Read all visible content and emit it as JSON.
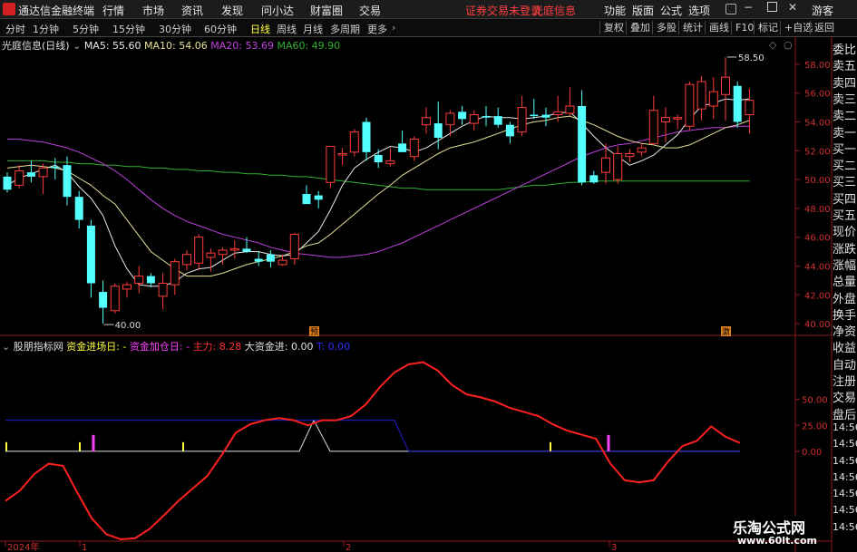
{
  "app": {
    "title": "通达信金融终端",
    "notice": "证券交易未登录",
    "stock_name": "光庭信息"
  },
  "menu": [
    "行情",
    "市场",
    "资讯",
    "发现",
    "问小达",
    "财富圈",
    "交易"
  ],
  "right_menu": [
    "功能",
    "版面",
    "公式",
    "选项",
    "游客"
  ],
  "timeframes": [
    "分时",
    "1分钟",
    "5分钟",
    "15分钟",
    "30分钟",
    "60分钟",
    "日线",
    "周线",
    "月线",
    "多周期",
    "更多"
  ],
  "active_timeframe": "日线",
  "toolbar_buttons": [
    "复权",
    "叠加",
    "多股",
    "统计",
    "画线",
    "F10",
    "标记",
    "+自选",
    "返回"
  ],
  "ma_header": {
    "title": "光庭信息(日线)",
    "ma5": "MA5: 55.60",
    "ma10": "MA10: 54.06",
    "ma20": "MA20: 53.69",
    "ma60": "MA60: 49.90"
  },
  "indicator_header": {
    "name": "股朋指标网",
    "i1": "资金进场日: -",
    "i2": "资金加仓日: -",
    "i3": "主力: 8.28",
    "i4": "大资金进: 0.00",
    "i5": "T: 0.00"
  },
  "price_axis": [
    "58.00",
    "56.00",
    "54.00",
    "52.00",
    "50.00",
    "48.00",
    "46.00",
    "44.00",
    "42.00",
    "40.00"
  ],
  "ind_axis": [
    "50.00",
    "25.00",
    "0.00"
  ],
  "annotations": {
    "high": "58.50",
    "low": "40.00",
    "marker_pre": "预",
    "marker_ji": "激"
  },
  "date_axis": [
    "2024年",
    "1",
    "2",
    "3"
  ],
  "sidebar": [
    "委比",
    "卖五",
    "卖四",
    "卖三",
    "卖二",
    "卖一",
    "买一",
    "买二",
    "买三",
    "买四",
    "买五",
    "现价",
    "涨跌",
    "涨幅",
    "总量",
    "外盘",
    "换手",
    "净资",
    "收益",
    "自动",
    "注册",
    "交易",
    "盘后",
    "14:56",
    "14:56",
    "14:56",
    "14:56",
    "14:56",
    "14:56",
    "14:56"
  ],
  "watermark": {
    "line1": "乐淘公式网",
    "line2": "www.60lt.com"
  },
  "colors": {
    "up": "#ff3c3c",
    "down": "#54ffff",
    "ma5": "#e8e8e8",
    "ma10": "#e8e09a",
    "ma20": "#c040e0",
    "ma60": "#30b030"
  },
  "chart_data": {
    "type": "candlestick",
    "y_range": [
      39.5,
      59.0
    ],
    "candles": [
      [
        50.2,
        50.5,
        49.1,
        49.3
      ],
      [
        49.6,
        51.0,
        49.4,
        50.6
      ],
      [
        50.5,
        51.3,
        49.8,
        50.2
      ],
      [
        50.2,
        51.1,
        49.0,
        50.8
      ],
      [
        50.9,
        51.5,
        50.0,
        50.8
      ],
      [
        51.0,
        51.6,
        48.2,
        48.8
      ],
      [
        48.8,
        49.2,
        46.6,
        47.2
      ],
      [
        46.8,
        47.2,
        41.8,
        42.8
      ],
      [
        42.2,
        43.0,
        40.0,
        41.1
      ],
      [
        40.9,
        42.8,
        40.7,
        42.6
      ],
      [
        42.4,
        42.9,
        41.8,
        42.7
      ],
      [
        42.8,
        44.0,
        42.1,
        43.3
      ],
      [
        43.3,
        43.5,
        42.5,
        42.8
      ],
      [
        41.9,
        43.5,
        41.0,
        42.8
      ],
      [
        42.7,
        44.5,
        42.0,
        44.3
      ],
      [
        44.1,
        45.1,
        43.7,
        44.8
      ],
      [
        44.2,
        46.2,
        43.7,
        46.0
      ],
      [
        44.6,
        45.2,
        43.6,
        44.9
      ],
      [
        44.8,
        45.3,
        44.1,
        45.1
      ],
      [
        45.1,
        45.8,
        44.5,
        45.2
      ],
      [
        45.2,
        46.0,
        44.9,
        45.0
      ],
      [
        44.5,
        45.0,
        44.0,
        44.3
      ],
      [
        44.8,
        45.1,
        43.9,
        44.3
      ],
      [
        44.1,
        44.8,
        44.0,
        44.4
      ],
      [
        44.5,
        46.3,
        44.1,
        46.2
      ],
      [
        49.0,
        49.6,
        48.6,
        48.3
      ],
      [
        48.9,
        49.2,
        48.0,
        48.6
      ],
      [
        49.8,
        52.3,
        49.4,
        52.3
      ],
      [
        51.7,
        52.2,
        51.0,
        51.8
      ],
      [
        51.9,
        53.5,
        51.6,
        53.3
      ],
      [
        54.0,
        54.3,
        51.3,
        51.9
      ],
      [
        51.7,
        52.1,
        50.8,
        51.2
      ],
      [
        51.1,
        52.2,
        50.9,
        51.3
      ],
      [
        52.5,
        53.4,
        52.5,
        51.9
      ],
      [
        51.6,
        53.0,
        51.3,
        52.8
      ],
      [
        53.8,
        55.0,
        53.2,
        54.3
      ],
      [
        53.9,
        55.4,
        52.1,
        52.9
      ],
      [
        53.8,
        54.8,
        53.0,
        54.6
      ],
      [
        54.7,
        55.1,
        53.8,
        54.2
      ],
      [
        53.9,
        54.8,
        53.4,
        54.5
      ],
      [
        54.4,
        55.1,
        53.7,
        54.3
      ],
      [
        54.4,
        55.0,
        53.6,
        53.8
      ],
      [
        53.8,
        54.0,
        52.5,
        53.0
      ],
      [
        53.3,
        55.8,
        53.0,
        55.0
      ],
      [
        54.5,
        55.6,
        54.2,
        54.4
      ],
      [
        54.5,
        55.0,
        53.7,
        54.3
      ],
      [
        54.5,
        55.8,
        54.0,
        54.7
      ],
      [
        54.6,
        56.4,
        54.4,
        55.1
      ],
      [
        55.1,
        56.2,
        49.6,
        49.8
      ],
      [
        50.3,
        50.6,
        49.7,
        49.8
      ],
      [
        50.5,
        52.5,
        49.7,
        51.5
      ],
      [
        50.0,
        52.3,
        49.7,
        51.8
      ],
      [
        51.6,
        52.1,
        51.2,
        51.8
      ],
      [
        51.9,
        52.5,
        51.6,
        52.2
      ],
      [
        52.5,
        55.8,
        52.4,
        54.8
      ],
      [
        54.0,
        55.0,
        52.6,
        54.3
      ],
      [
        54.2,
        54.5,
        53.5,
        54.3
      ],
      [
        53.7,
        56.8,
        53.4,
        56.6
      ],
      [
        54.9,
        57.2,
        54.1,
        56.8
      ],
      [
        55.1,
        57.1,
        54.2,
        56.1
      ],
      [
        55.9,
        58.5,
        54.1,
        57.1
      ],
      [
        56.5,
        56.8,
        53.6,
        54.0
      ],
      [
        54.5,
        56.3,
        53.2,
        55.5
      ]
    ],
    "ma5": [
      49.6,
      50.1,
      50.4,
      50.7,
      51.0,
      50.5,
      49.5,
      48.7,
      47.5,
      45.4,
      43.8,
      42.7,
      42.6,
      42.6,
      42.9,
      43.5,
      43.8,
      43.9,
      44.4,
      44.9,
      45.0,
      45.0,
      44.8,
      44.7,
      44.8,
      45.6,
      46.4,
      47.9,
      49.6,
      50.8,
      51.4,
      51.9,
      52.3,
      52.2,
      51.9,
      52.2,
      52.7,
      53.2,
      53.7,
      54.1,
      54.4,
      54.3,
      54.3,
      54.2,
      54.3,
      54.4,
      54.6,
      54.7,
      53.9,
      53.0,
      52.2,
      51.6,
      51.0,
      51.3,
      51.7,
      52.4,
      53.1,
      54.2,
      55.1,
      55.3,
      55.6,
      55.5,
      55.6
    ],
    "ma10": [
      50.8,
      50.9,
      51.0,
      50.9,
      50.8,
      50.6,
      50.1,
      49.6,
      48.9,
      48.3,
      47.2,
      46.1,
      45.0,
      44.4,
      43.8,
      43.3,
      43.3,
      43.3,
      43.5,
      43.8,
      44.1,
      44.3,
      44.5,
      44.7,
      45.0,
      45.4,
      45.6,
      46.2,
      46.9,
      47.6,
      48.3,
      49.0,
      49.6,
      50.3,
      50.8,
      51.3,
      51.8,
      52.2,
      52.4,
      52.6,
      52.9,
      53.2,
      53.5,
      53.8,
      54.0,
      54.1,
      54.3,
      54.4,
      54.1,
      53.8,
      53.4,
      53.0,
      52.7,
      52.5,
      52.4,
      52.2,
      52.2,
      52.4,
      52.8,
      53.2,
      53.6,
      53.8,
      54.1
    ],
    "ma20": [
      52.8,
      52.8,
      52.7,
      52.6,
      52.4,
      52.2,
      51.9,
      51.5,
      51.1,
      50.6,
      50.0,
      49.3,
      48.6,
      48.0,
      47.5,
      47.1,
      46.8,
      46.5,
      46.2,
      46.0,
      45.8,
      45.6,
      45.3,
      45.1,
      44.9,
      44.8,
      44.7,
      44.6,
      44.6,
      44.7,
      44.8,
      45.0,
      45.3,
      45.6,
      46.0,
      46.4,
      46.8,
      47.2,
      47.6,
      48.0,
      48.4,
      48.8,
      49.2,
      49.6,
      50.0,
      50.4,
      50.8,
      51.2,
      51.6,
      51.9,
      52.2,
      52.4,
      52.5,
      52.7,
      52.9,
      53.1,
      53.3,
      53.4,
      53.5,
      53.6,
      53.6,
      53.7,
      53.7
    ],
    "ma60": [
      51.3,
      51.3,
      51.3,
      51.3,
      51.2,
      51.2,
      51.1,
      51.1,
      51.0,
      51.0,
      50.9,
      50.9,
      50.8,
      50.8,
      50.7,
      50.7,
      50.6,
      50.6,
      50.5,
      50.5,
      50.4,
      50.4,
      50.3,
      50.3,
      50.2,
      50.2,
      50.1,
      50.0,
      49.9,
      49.8,
      49.7,
      49.6,
      49.5,
      49.4,
      49.4,
      49.3,
      49.3,
      49.3,
      49.3,
      49.3,
      49.3,
      49.3,
      49.4,
      49.5,
      49.6,
      49.6,
      49.7,
      49.8,
      49.8,
      49.9,
      49.9,
      49.9,
      49.9,
      49.9,
      49.9,
      49.9,
      49.9,
      49.9,
      49.9,
      49.9,
      49.9,
      49.9,
      49.9
    ],
    "indicator": {
      "y_range": [
        -85,
        90
      ],
      "main_force": [
        -48,
        -38,
        -22,
        -12,
        -14,
        -40,
        -65,
        -80,
        -85,
        -84,
        -75,
        -62,
        -48,
        -36,
        -24,
        -4,
        18,
        26,
        30,
        32,
        30,
        25,
        30,
        30,
        34,
        45,
        62,
        76,
        84,
        86,
        78,
        64,
        55,
        52,
        48,
        42,
        38,
        34,
        26,
        20,
        16,
        12,
        -12,
        -28,
        -30,
        -28,
        -10,
        5,
        10,
        24,
        14,
        8
      ],
      "big_money": [
        30,
        30,
        30,
        30,
        30,
        30,
        30,
        30,
        30,
        30,
        30,
        30,
        30,
        30,
        30,
        30,
        30,
        30,
        30,
        30,
        30,
        30,
        30,
        30,
        30,
        30,
        30,
        30,
        0,
        0,
        0,
        0,
        0,
        0,
        0,
        0,
        0,
        0,
        0,
        0,
        0,
        0,
        0,
        0,
        0,
        0,
        0,
        0,
        0,
        0,
        0,
        0
      ]
    }
  }
}
